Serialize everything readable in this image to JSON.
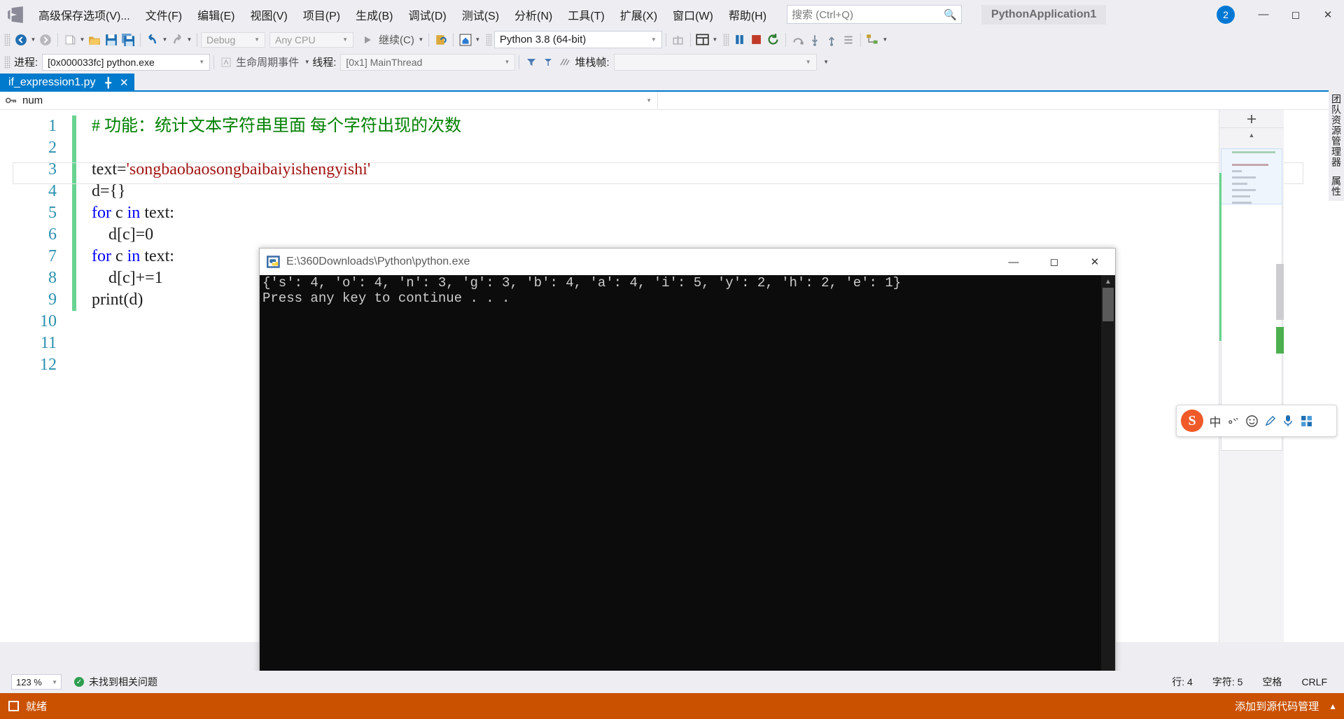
{
  "menubar": {
    "logo_icon": "visual-studio-logo",
    "items": [
      "高级保存选项(V)...",
      "文件(F)",
      "编辑(E)",
      "视图(V)",
      "项目(P)",
      "生成(B)",
      "调试(D)",
      "测试(S)",
      "分析(N)",
      "工具(T)",
      "扩展(X)",
      "窗口(W)",
      "帮助(H)"
    ],
    "search_placeholder": "搜索 (Ctrl+Q)",
    "search_icon": "search-icon",
    "project_chip": "PythonApplication1",
    "notification_count": "2",
    "minimize_icon": "minimize-icon",
    "maximize_icon": "maximize-icon",
    "close_icon": "close-icon"
  },
  "toolbar": {
    "nav_back_icon": "navigate-back-icon",
    "nav_forward_icon": "navigate-forward-icon",
    "new_project_icon": "new-project-icon",
    "open_file_icon": "open-file-icon",
    "save_icon": "save-icon",
    "save_all_icon": "save-all-icon",
    "undo_icon": "undo-icon",
    "redo_icon": "redo-icon",
    "config_value": "Debug",
    "platform_value": "Any CPU",
    "start_label": "继续(C)",
    "start_icon": "play-icon",
    "attach_icon": "attach-process-icon",
    "home_icon": "python-env-icon",
    "interpreter_value": "Python 3.8 (64-bit)",
    "gift_icon": "gift-icon",
    "layout_icon": "window-layout-icon",
    "pause_icon": "pause-icon",
    "stop_icon": "stop-icon",
    "restart_icon": "restart-icon",
    "step_over_icon": "step-over-icon",
    "step_into_icon": "step-into-icon",
    "step_out_icon": "step-out-icon",
    "step_more_icon": "step-more-icon",
    "hierarchy_icon": "hierarchy-icon"
  },
  "debugbar": {
    "process_label": "进程:",
    "process_value": "[0x000033fc] python.exe",
    "lifecycle_icon": "lifecycle-events-icon",
    "lifecycle_label": "生命周期事件",
    "thread_label": "线程:",
    "thread_value": "[0x1] MainThread",
    "filter_icon": "filter-icon",
    "flag_icon": "flag-icon",
    "stack_icon": "stack-icon",
    "stackframe_label": "堆栈帧:",
    "stackframe_value": ""
  },
  "tabstrip": {
    "active_tab": "if_expression1.py",
    "pin_icon": "pin-icon",
    "close_icon": "close-tab-icon",
    "overflow_icon": "chevron-down-icon"
  },
  "navbar": {
    "key_icon": "key-icon",
    "member_value": "num",
    "caret_icon": "chevron-down-icon",
    "type_value": ""
  },
  "editor": {
    "line_numbers": [
      "1",
      "2",
      "3",
      "4",
      "5",
      "6",
      "7",
      "8",
      "9",
      "10",
      "11",
      "12"
    ],
    "changebar_flags": [
      true,
      true,
      true,
      true,
      true,
      true,
      true,
      true,
      true,
      false,
      false,
      false
    ],
    "lines": [
      {
        "n": 1,
        "segments": [
          {
            "t": "# 功能：统计文本字符串里面 每个字符出现的次数",
            "c": "cmt"
          }
        ]
      },
      {
        "n": 2,
        "segments": [
          {
            "t": "",
            "c": ""
          }
        ]
      },
      {
        "n": 3,
        "segments": [
          {
            "t": "text=",
            "c": ""
          },
          {
            "t": "'songbaobaosongbaibaiyishengyishi'",
            "c": "str"
          }
        ]
      },
      {
        "n": 4,
        "segments": [
          {
            "t": "d={}",
            "c": ""
          }
        ]
      },
      {
        "n": 5,
        "segments": [
          {
            "t": "for",
            "c": "kw"
          },
          {
            "t": " c ",
            "c": ""
          },
          {
            "t": "in",
            "c": "kw"
          },
          {
            "t": " text:",
            "c": ""
          }
        ]
      },
      {
        "n": 6,
        "segments": [
          {
            "t": "    d[c]=0",
            "c": ""
          }
        ]
      },
      {
        "n": 7,
        "segments": [
          {
            "t": "for",
            "c": "kw"
          },
          {
            "t": " c ",
            "c": ""
          },
          {
            "t": "in",
            "c": "kw"
          },
          {
            "t": " text:",
            "c": ""
          }
        ]
      },
      {
        "n": 8,
        "segments": [
          {
            "t": "    d[c]+=1",
            "c": ""
          }
        ]
      },
      {
        "n": 9,
        "segments": [
          {
            "t": "print(d)",
            "c": ""
          }
        ]
      },
      {
        "n": 10,
        "segments": [
          {
            "t": "",
            "c": ""
          }
        ]
      },
      {
        "n": 11,
        "segments": [
          {
            "t": "",
            "c": ""
          }
        ]
      },
      {
        "n": 12,
        "segments": [
          {
            "t": "",
            "c": ""
          }
        ]
      }
    ],
    "minimap_icon": "minimap-toggle-icon",
    "scroll_up_icon": "scroll-up-icon",
    "scroll_down_icon": "scroll-down-icon"
  },
  "right_rail": {
    "items": [
      "团队资源管理器",
      "属性"
    ]
  },
  "console": {
    "icon": "python-exe-icon",
    "title": "E:\\360Downloads\\Python\\python.exe",
    "minimize_icon": "minimize-icon",
    "maximize_icon": "maximize-icon",
    "close_icon": "close-icon",
    "output_lines": [
      "{'s': 4, 'o': 4, 'n': 3, 'g': 3, 'b': 4, 'a': 4, 'i': 5, 'y': 2, 'h': 2, 'e': 1}",
      "Press any key to continue . . ."
    ],
    "scroll_up_icon": "scroll-up-icon",
    "scroll_down_icon": "scroll-down-icon"
  },
  "ime": {
    "logo_text": "S",
    "mode_label": "中",
    "keyboard_icon": "keyboard-icon",
    "emoji_icon": "emoji-icon",
    "pen_icon": "pen-icon",
    "mic_icon": "microphone-icon",
    "apps_icon": "apps-grid-icon"
  },
  "editor_status": {
    "zoom": "123 %",
    "zoom_caret_icon": "chevron-down-icon",
    "error_status": "未找到相关问题",
    "error_icon": "check-circle-icon",
    "line": "行: 4",
    "column": "字符: 5",
    "indent": "空格",
    "eol": "CRLF"
  },
  "statusbar": {
    "ready_icon": "ready-icon",
    "ready_text": "就绪",
    "right_text": "添加到源代码管理",
    "up_icon": "chevron-up-icon"
  },
  "watermark": {
    "url": "https://blog.csdn.net/weixin_43949535"
  },
  "colors": {
    "accent_blue": "#007acc",
    "statusbar_orange": "#ca5100",
    "keyword_blue": "#0000ff",
    "comment_green": "#008000",
    "string_red": "#a31515",
    "linenum_teal": "#2b91af",
    "changebar_green": "#68d391",
    "console_bg": "#0c0c0c",
    "chrome_bg": "#eeeef2"
  }
}
